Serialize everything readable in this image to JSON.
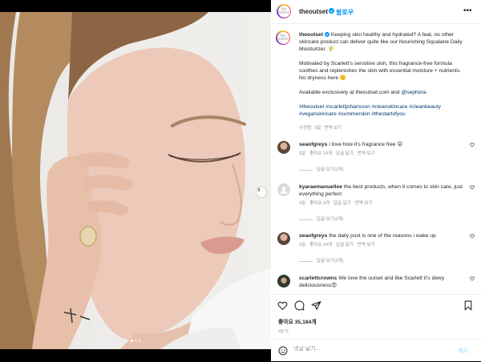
{
  "header": {
    "username": "theoutset",
    "follow_label": "팔로우",
    "more_label": "•••"
  },
  "logo_text": "the outset",
  "caption": {
    "username": "theoutset",
    "text1": "Keeping skin healthy and hydrated? A feat, no other skincare product can deliver quite like our Nourishing Squalane Daily Moisturizer. 🌾",
    "text2": "Motivated by Scarlett's sensitive skin, this fragrance-free formula soothes and replenishes the skin with essential moisture + nutrients. No dryness here 🙂",
    "text3_prefix": "Available exclusively at theoutset.com and ",
    "text3_mention": "@sephora",
    "text3_suffix": ".",
    "hashtags": "#theoutset #scarlettjohansson #cleanskincare #cleanbeauty #veganskincare #summerskin #thestartofyou",
    "edited": "수정됨",
    "age": "3일",
    "translate": "번역 보기"
  },
  "comments": [
    {
      "username": "seaofgreys",
      "text": "i love how it's fragrance free 😮",
      "age": "3일",
      "likes": "좋아요 14개",
      "reply": "답글 달기",
      "translate": "번역 보기",
      "view_replies": "답글 보기(1개)"
    },
    {
      "username": "kyaraemanuellee",
      "text": "the best products, when it comes to skin care, just everything perfect",
      "age": "3일",
      "likes": "좋아요 9개",
      "reply": "답글 달기",
      "translate": "번역 보기",
      "view_replies": "답글 보기(2개)"
    },
    {
      "username": "seaofgreys",
      "text": "the daily post is one of the reasons i wake up",
      "age": "3일",
      "likes": "좋아요 14개",
      "reply": "답글 달기",
      "translate": "번역 보기",
      "view_replies": "답글 보기(2개)"
    },
    {
      "username": "scarlettcrowns",
      "text": "We love the outset and like Scarlett it's dewy deliciousness😍",
      "age": "",
      "likes": "",
      "reply": "",
      "translate": "",
      "view_replies": ""
    }
  ],
  "actions": {
    "likes": "좋아요 35,184개",
    "posted": "3일 전",
    "comment_placeholder": "댓글 달기...",
    "post_label": "게시"
  },
  "carousel": {
    "slides": 3,
    "active": 1
  },
  "colors": {
    "verified": "#0095f6",
    "follow": "#0095f6",
    "post_disabled": "#b2dffc"
  }
}
